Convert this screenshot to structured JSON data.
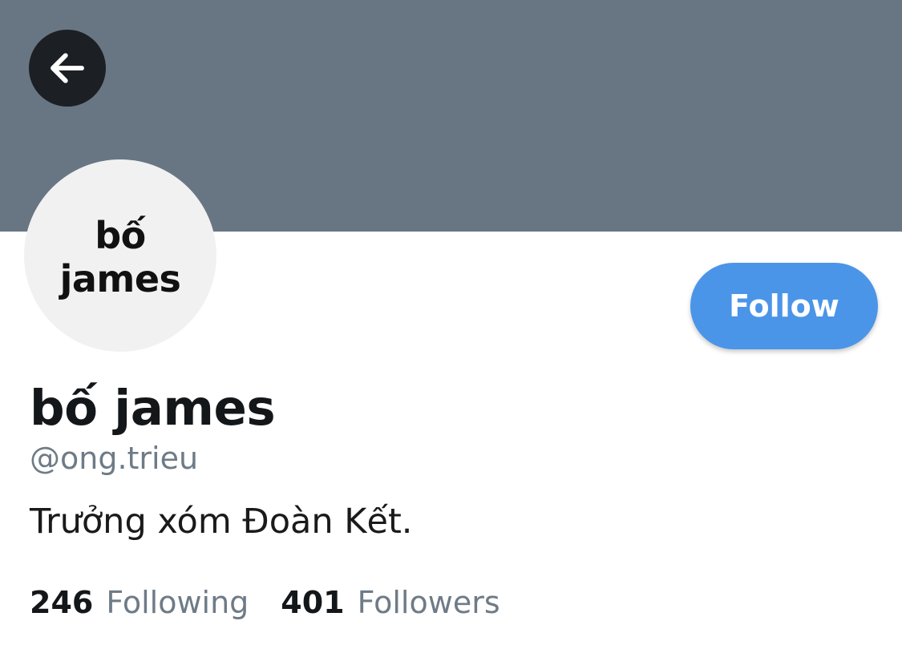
{
  "profile": {
    "avatar_text_line1": "bố",
    "avatar_text_line2": "james",
    "display_name": "bố james",
    "handle": "@ong.trieu",
    "bio": "Trưởng xóm Đoàn Kết."
  },
  "actions": {
    "follow_label": "Follow",
    "back_icon": "arrow-left-icon"
  },
  "stats": {
    "following_count": "246",
    "following_label": "Following",
    "followers_count": "401",
    "followers_label": "Followers"
  },
  "colors": {
    "banner": "#687684",
    "follow_button": "#4a95e8",
    "back_button": "#1c1f23",
    "muted_text": "#6e7b87"
  }
}
